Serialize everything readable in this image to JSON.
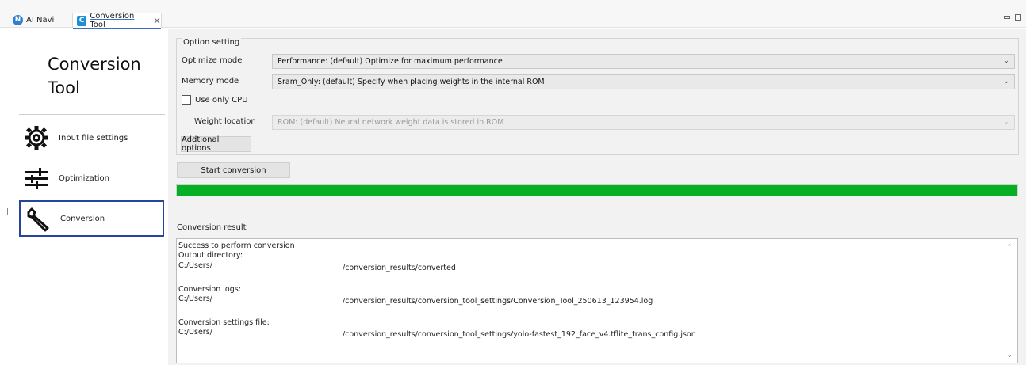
{
  "tabs": {
    "ai_navi": {
      "label": "AI Navi",
      "icon": "ai-navi-icon",
      "icon_glyph": "N"
    },
    "conversion_tool": {
      "label": "Conversion Tool",
      "icon": "conversion-tool-icon",
      "icon_glyph": "C",
      "close": "×"
    }
  },
  "window_controls": {
    "minimize": "minimize-icon",
    "maximize": "maximize-icon"
  },
  "sidebar": {
    "title_line1": "Conversion",
    "title_line2": "Tool",
    "items": [
      {
        "label": "Input file settings",
        "icon": "gear-icon",
        "glyph": "⚙"
      },
      {
        "label": "Optimization",
        "icon": "sliders-icon",
        "glyph": "☰"
      },
      {
        "label": "Conversion",
        "icon": "wrench-icon",
        "glyph": "🔧",
        "selected": true
      }
    ]
  },
  "options": {
    "legend": "Option setting",
    "optimize_label": "Optimize mode",
    "optimize_value": "Performance: (default) Optimize for maximum performance",
    "memory_label": "Memory mode",
    "memory_value": "Sram_Only: (default) Specify when placing weights in the internal ROM",
    "cpu_label": "Use only CPU",
    "cpu_checked": false,
    "weight_label": "Weight location",
    "weight_value": "ROM: (default) Neural network weight data is stored in ROM",
    "additional_button": "Addtional options"
  },
  "actions": {
    "start_button": "Start conversion"
  },
  "progress": {
    "fraction": 1.0,
    "color": "#06b025"
  },
  "result": {
    "label": "Conversion result",
    "lines": {
      "l1": "Success to perform conversion",
      "l2": "Output directory:",
      "l3a": "C:/Users/",
      "l3b": "/conversion_results/converted",
      "l4": "Conversion logs:",
      "l5a": "C:/Users/",
      "l5b": "/conversion_results/conversion_tool_settings/Conversion_Tool_250613_123954.log",
      "l6": "Conversion settings file:",
      "l7a": "C:/Users/",
      "l7b": "/conversion_results/conversion_tool_settings/yolo-fastest_192_face_v4.tflite_trans_config.json"
    }
  },
  "colors": {
    "accent": "#27469b",
    "tab_underline": "#3b6fc6",
    "progress_fill": "#06b025"
  }
}
